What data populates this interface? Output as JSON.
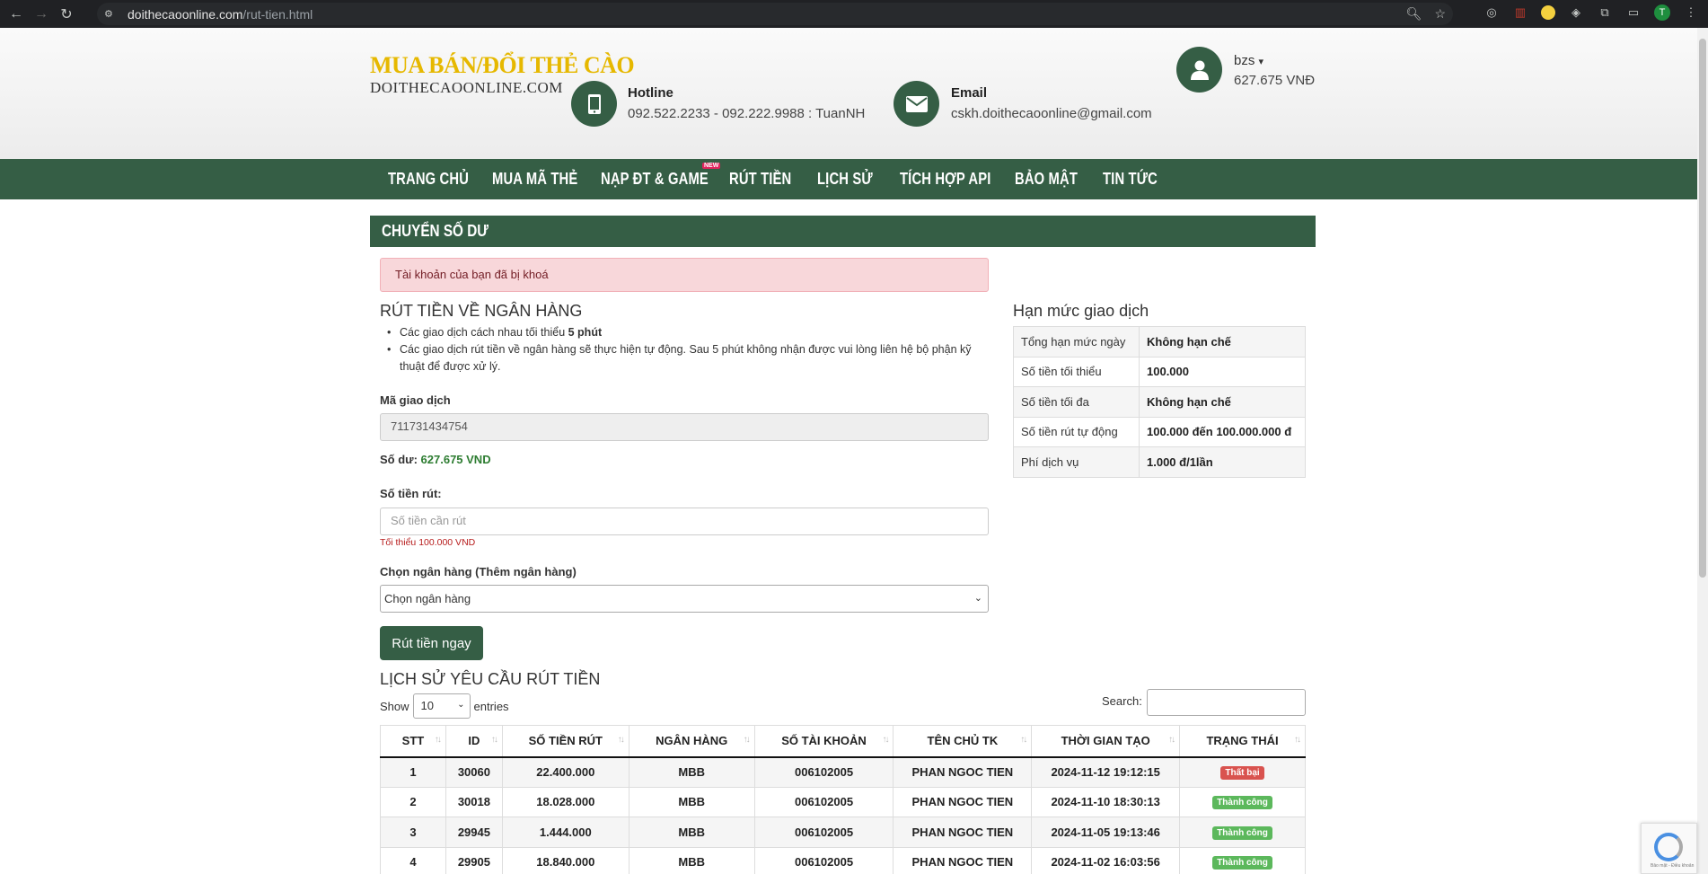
{
  "browser": {
    "url_domain": "doithecaoonline.com",
    "url_path": "/rut-tien.html",
    "profile_initial": "T"
  },
  "header": {
    "logo_line1": "MUA BÁN/ĐỔI THẺ CÀO",
    "logo_line2": "DOITHECAOONLINE.COM",
    "hotline_label": "Hotline",
    "hotline_value": "092.522.2233 - 092.222.9988 : TuanNH",
    "email_label": "Email",
    "email_value": "cskh.doithecaoonline@gmail.com",
    "username": "bzs",
    "balance": "627.675 VNĐ"
  },
  "nav": {
    "items": [
      "TRANG CHỦ",
      "MUA MÃ THẺ",
      "NẠP ĐT & GAME",
      "RÚT TIỀN",
      "LỊCH SỬ",
      "TÍCH HỢP API",
      "BẢO MẬT",
      "TIN TỨC"
    ],
    "new_badge": "NEW"
  },
  "section": {
    "title": "CHUYỂN SỐ DƯ",
    "alert": "Tài khoản của bạn đã bị khoá"
  },
  "withdraw_form": {
    "heading": "RÚT TIỀN VỀ NGÂN HÀNG",
    "rule1_prefix": "Các giao dịch cách nhau tối thiểu ",
    "rule1_bold": "5 phút",
    "rule2": "Các giao dịch rút tiền về ngân hàng sẽ thực hiện tự động. Sau 5 phút không nhận được vui lòng liên hệ bộ phận kỹ thuật để được xử lý.",
    "txn_label": "Mã giao dịch",
    "txn_value": "711731434754",
    "balance_label": "Số dư: ",
    "balance_value": "627.675 VND",
    "amount_label": "Số tiền rút:",
    "amount_placeholder": "Số tiền cần rút",
    "amount_hint": "Tối thiểu 100.000 VND",
    "bank_label": "Chọn ngân hàng (Thêm ngân hàng)",
    "bank_selected": "Chọn ngân hàng",
    "submit_label": "Rút tiền ngay"
  },
  "limits": {
    "heading": "Hạn mức giao dịch",
    "rows": [
      {
        "key": "Tổng hạn mức ngày",
        "value": "Không hạn chế"
      },
      {
        "key": "Số tiền tối thiểu",
        "value": "100.000"
      },
      {
        "key": "Số tiền tối đa",
        "value": "Không hạn chế"
      },
      {
        "key": "Số tiền rút tự động",
        "value": "100.000 đến 100.000.000 đ"
      },
      {
        "key": "Phí dịch vụ",
        "value": "1.000 đ/1lần"
      }
    ]
  },
  "history": {
    "heading": "LỊCH SỬ YÊU CẦU RÚT TIỀN",
    "show_label": "Show",
    "entries_value": "10",
    "entries_label": "entries",
    "search_label": "Search:",
    "columns": [
      "STT",
      "ID",
      "SỐ TIỀN RÚT",
      "NGÂN HÀNG",
      "SỐ TÀI KHOẢN",
      "TÊN CHỦ TK",
      "THỜI GIAN TẠO",
      "TRẠNG THÁI"
    ],
    "rows": [
      {
        "stt": "1",
        "id": "30060",
        "amount": "22.400.000",
        "bank": "MBB",
        "account": "006102005",
        "owner": "PHAN NGOC TIEN",
        "time": "2024-11-12 19:12:15",
        "status": "Thất bại",
        "status_type": "fail"
      },
      {
        "stt": "2",
        "id": "30018",
        "amount": "18.028.000",
        "bank": "MBB",
        "account": "006102005",
        "owner": "PHAN NGOC TIEN",
        "time": "2024-11-10 18:30:13",
        "status": "Thành công",
        "status_type": "ok"
      },
      {
        "stt": "3",
        "id": "29945",
        "amount": "1.444.000",
        "bank": "MBB",
        "account": "006102005",
        "owner": "PHAN NGOC TIEN",
        "time": "2024-11-05 19:13:46",
        "status": "Thành công",
        "status_type": "ok"
      },
      {
        "stt": "4",
        "id": "29905",
        "amount": "18.840.000",
        "bank": "MBB",
        "account": "006102005",
        "owner": "PHAN NGOC TIEN",
        "time": "2024-11-02 16:03:56",
        "status": "Thành công",
        "status_type": "ok"
      }
    ]
  },
  "recaptcha_text": "Bảo mật - Điều khoản",
  "colors": {
    "brand_green": "#355e45",
    "logo_yellow": "#e6b800",
    "fail": "#d9534f",
    "success": "#5cb85c"
  }
}
